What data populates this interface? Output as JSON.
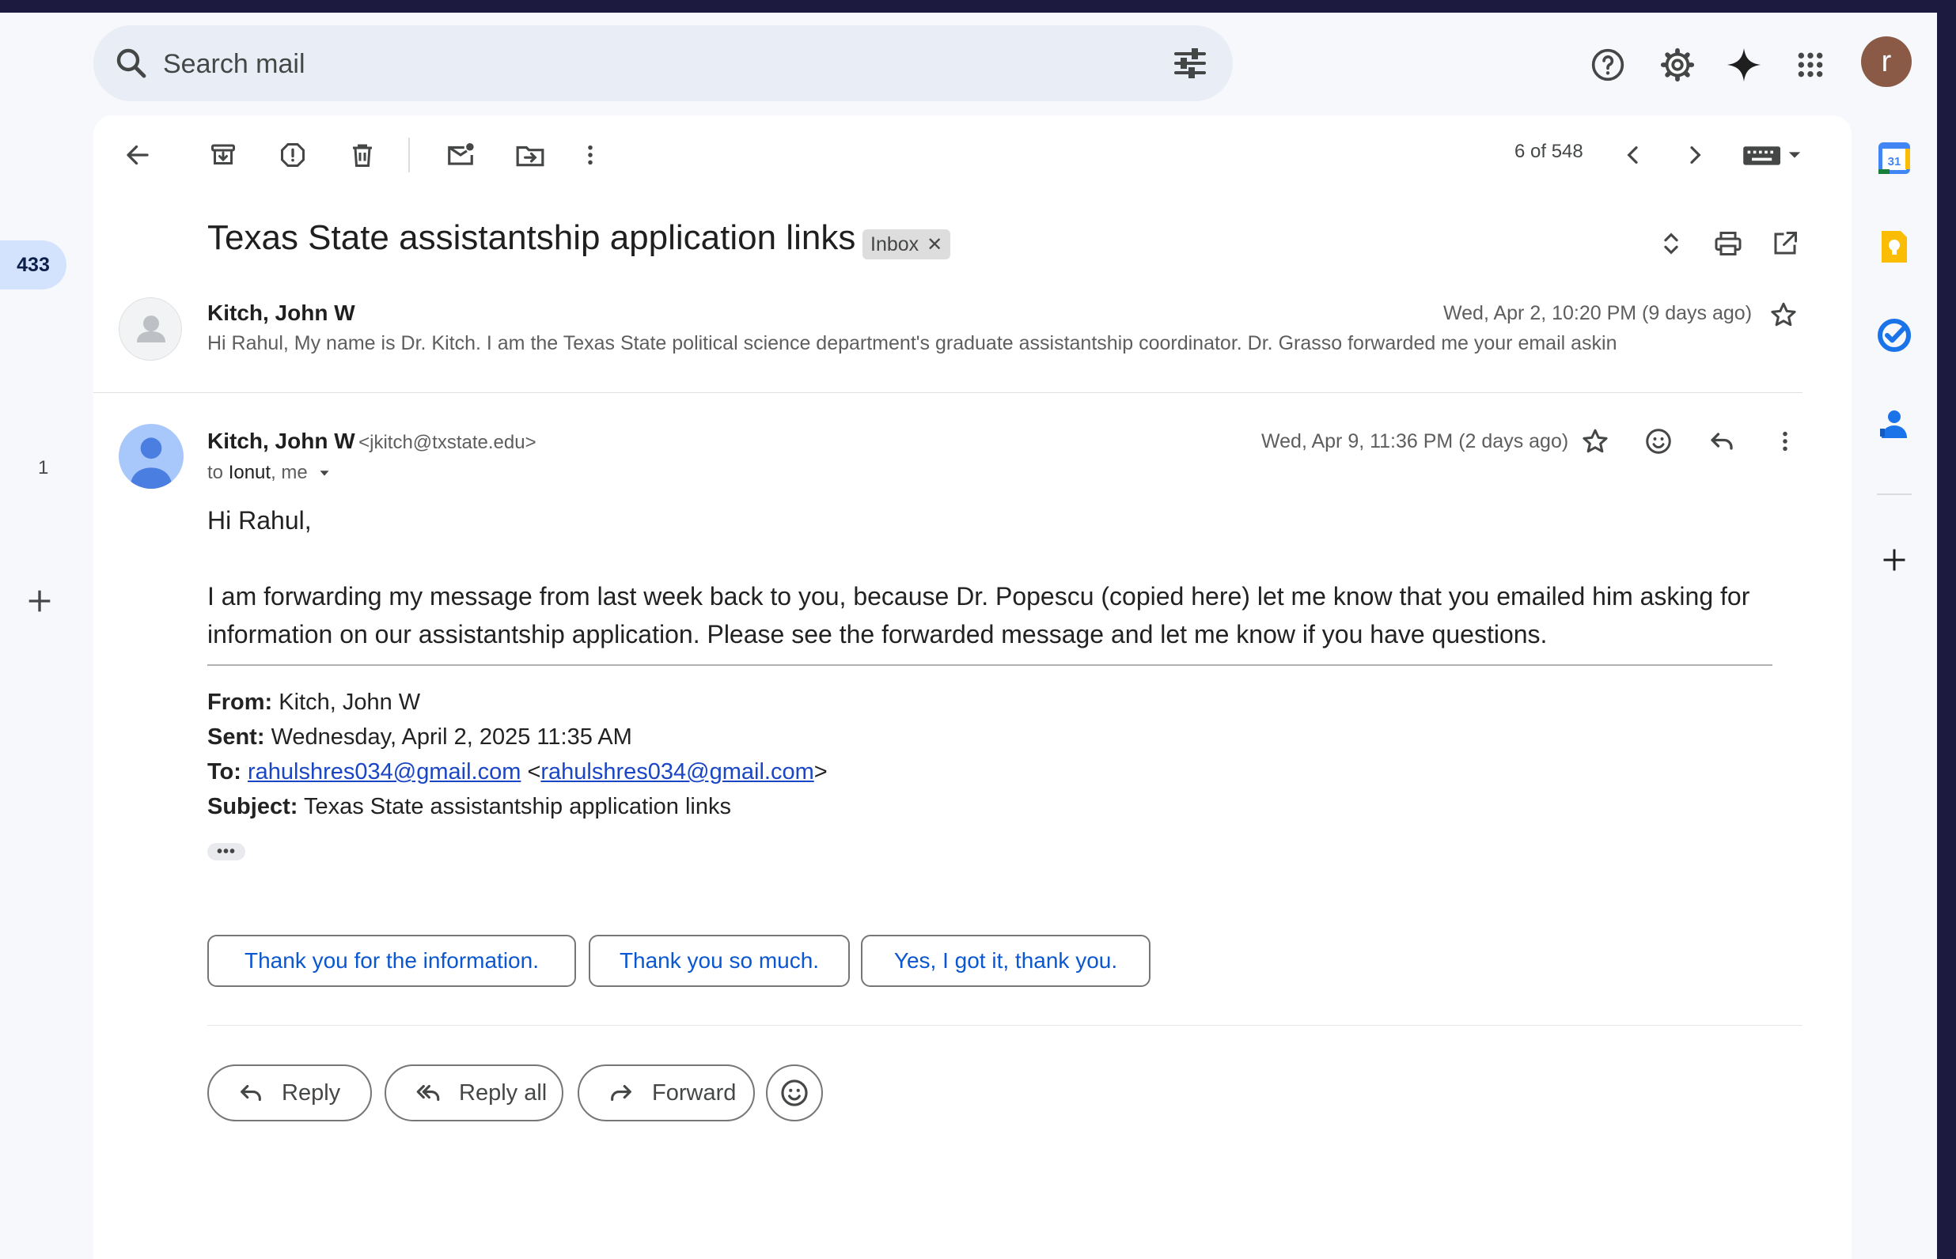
{
  "search": {
    "placeholder": "Search mail"
  },
  "left_rail": {
    "badge_count": "433",
    "count_label": "1"
  },
  "toolbar": {
    "pager": "6 of 548"
  },
  "thread": {
    "subject": "Texas State assistantship application links",
    "label_chip": "Inbox"
  },
  "collapsed_message": {
    "sender": "Kitch, John W",
    "date": "Wed, Apr 2, 10:20 PM (9 days ago)",
    "snippet": "Hi Rahul, My name is Dr. Kitch. I am the Texas State political science department's graduate assistantship coordinator. Dr. Grasso forwarded me your email askin"
  },
  "message": {
    "sender": "Kitch, John W",
    "email": "<jkitch@txstate.edu>",
    "to_prefix": "to",
    "to_name": "Ionut",
    "to_rest": ", me",
    "date": "Wed, Apr 9, 11:36 PM (2 days ago)",
    "greeting": "Hi Rahul,",
    "para_line1": "I am forwarding my message from last week back to you, because Dr. Popescu (copied here) let me know that you emailed him asking for",
    "para_line2": "information on our assistantship application. Please see the forwarded message and let me know if you have questions.",
    "fw_from_label": "From:",
    "fw_from": "Kitch, John W",
    "fw_sent_label": "Sent:",
    "fw_sent": "Wednesday, April 2, 2025 11:35 AM",
    "fw_to_label": "To:",
    "fw_to_link1": "rahulshres034@gmail.com",
    "fw_to_lt": "<",
    "fw_to_link2": "rahulshres034@gmail.com",
    "fw_to_gt": ">",
    "fw_subject_label": "Subject:",
    "fw_subject": "Texas State assistantship application links",
    "ellipsis": "•••"
  },
  "smart_replies": [
    "Thank you for the information.",
    "Thank you so much.",
    "Yes, I got it, thank you."
  ],
  "actions": {
    "reply": "Reply",
    "reply_all": "Reply all",
    "forward": "Forward"
  },
  "account": {
    "avatar_letter": "r"
  },
  "calendar_icon_text": "31",
  "colors": {
    "accent_blue": "#0b57d0",
    "search_bg": "#e9eef6",
    "badge_bg": "#d3e3fd",
    "avatar_brown": "#8a5a47"
  }
}
